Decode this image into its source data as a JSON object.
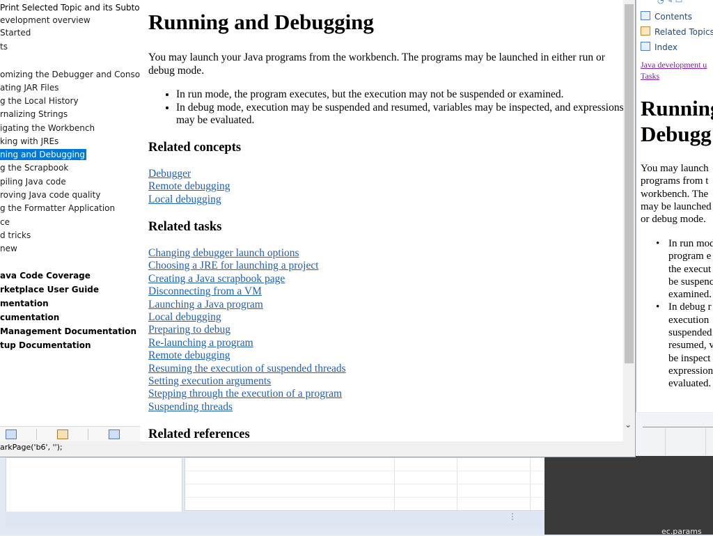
{
  "toc": {
    "header": "Print Selected Topic and its Subtopics",
    "items": [
      {
        "label": "evelopment overview",
        "bold": false,
        "selected": false
      },
      {
        "label": " Started",
        "bold": false,
        "selected": false
      },
      {
        "label": "ts",
        "bold": false,
        "selected": false
      },
      {
        "label": "",
        "bold": false,
        "selected": false
      },
      {
        "label": "omizing the Debugger and Console",
        "bold": false,
        "selected": false
      },
      {
        "label": "ating JAR Files",
        "bold": false,
        "selected": false
      },
      {
        "label": "g the Local History",
        "bold": false,
        "selected": false
      },
      {
        "label": "rnalizing Strings",
        "bold": false,
        "selected": false
      },
      {
        "label": "igating the Workbench",
        "bold": false,
        "selected": false
      },
      {
        "label": "king with JREs",
        "bold": false,
        "selected": false
      },
      {
        "label": "ning and Debugging",
        "bold": false,
        "selected": true
      },
      {
        "label": "g the Scrapbook",
        "bold": false,
        "selected": false
      },
      {
        "label": "piling Java code",
        "bold": false,
        "selected": false
      },
      {
        "label": "roving Java code quality",
        "bold": false,
        "selected": false
      },
      {
        "label": "g the Formatter Application",
        "bold": false,
        "selected": false
      },
      {
        "label": "ce",
        "bold": false,
        "selected": false
      },
      {
        "label": "d tricks",
        "bold": false,
        "selected": false
      },
      {
        "label": "new",
        "bold": false,
        "selected": false
      },
      {
        "label": "",
        "bold": false,
        "selected": false
      },
      {
        "label": "ava Code Coverage",
        "bold": true,
        "selected": false
      },
      {
        "label": "rketplace User Guide",
        "bold": true,
        "selected": false
      },
      {
        "label": "mentation",
        "bold": true,
        "selected": false
      },
      {
        "label": "cumentation",
        "bold": true,
        "selected": false
      },
      {
        "label": " Management Documentation",
        "bold": true,
        "selected": false
      },
      {
        "label": "tup Documentation",
        "bold": true,
        "selected": false
      }
    ],
    "status": "arkPage('b6', '');"
  },
  "content": {
    "title": "Running and Debugging",
    "intro": "You may launch your Java programs from the workbench.  The programs may be launched in either run or debug mode.",
    "bullets": [
      "In run mode, the program executes, but the execution may not be suspended or examined.",
      "In debug mode, execution may be suspended and resumed, variables may be inspected, and expressions may be evaluated."
    ],
    "concepts_heading": "Related concepts",
    "concepts": [
      "Debugger",
      "Remote debugging",
      "Local debugging"
    ],
    "tasks_heading": "Related tasks",
    "tasks": [
      "Changing debugger launch options",
      "Choosing a JRE for launching a project",
      "Creating a Java scrapbook page",
      "Disconnecting from a VM",
      "Launching a Java program",
      "Local debugging",
      "Preparing to debug",
      "Re-launching a program",
      "Remote debugging",
      "Resuming the execution of suspended threads",
      "Setting execution arguments",
      "Stepping through the execution of a program",
      "Suspending threads"
    ],
    "references_heading": "Related references"
  },
  "side": {
    "tabs": [
      {
        "label": "Contents",
        "icon": "contents-icon"
      },
      {
        "label": "Related Topics",
        "icon": "related-topics-icon"
      },
      {
        "label": "Index",
        "icon": "index-icon"
      }
    ],
    "crumb1": "Java development u",
    "crumb2": "Tasks",
    "title_line1": "Running",
    "title_line2": "Debugg",
    "text_lines": [
      "You may launch",
      "programs from t",
      "workbench.  The",
      "may be launched",
      "or debug mode."
    ],
    "bullet1_lines": [
      "In run mod",
      "program e",
      "the execut",
      "be suspenc",
      "examined."
    ],
    "bullet2_lines": [
      "In debug r",
      "execution",
      "suspended",
      "resumed, v",
      "be inspect",
      "expression",
      "evaluated."
    ]
  },
  "background": {
    "dark_label": "ec.params"
  }
}
